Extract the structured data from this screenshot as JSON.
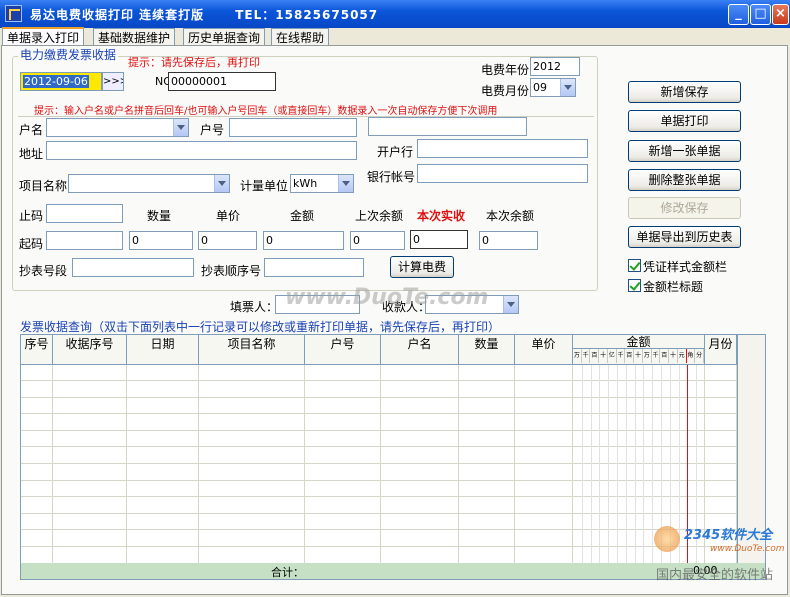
{
  "window": {
    "title": "易达电费收据打印 连续套打版      TEL：15825675057"
  },
  "tabs": [
    {
      "label": "单据录入打印",
      "active": true
    },
    {
      "label": "基础数据维护",
      "active": false
    },
    {
      "label": "历史单据查询",
      "active": false
    },
    {
      "label": "在线帮助",
      "active": false
    }
  ],
  "form": {
    "section_title": "电力缴费发票收据",
    "tip_top": "提示：请先保存后，再打印",
    "date_value": "2012-09-06",
    "date_button": ">>>",
    "no_label": "NO",
    "no_value": "00000001",
    "year_label": "电费年份",
    "year_value": "2012",
    "month_label": "电费月份",
    "month_value": "09",
    "tip_main": "提示：输入户名或户名拼音后回车/也可输入户号回车（或直接回车）数据录入一次自动保存方便下次调用",
    "huming_label": "户名",
    "huhao_label": "户号",
    "address_label": "地址",
    "bank_label": "开户行",
    "item_label": "项目名称",
    "unit_label": "计量单位",
    "unit_value": "kWh",
    "account_label": "银行帐号",
    "stop_label": "止码",
    "start_label": "起码",
    "qty_label": "数量",
    "price_label": "单价",
    "amount_label": "金额",
    "prev_balance_label": "上次余额",
    "actual_label": "本次实收",
    "curr_balance_label": "本次余额",
    "qty_value": "0",
    "price_value": "0",
    "amount_value": "0",
    "prev_balance_value": "0",
    "actual_value": "0",
    "curr_balance_value": "0",
    "meter_seg_label": "抄表号段",
    "meter_seq_label": "抄表顺序号",
    "calc_button": "计算电费",
    "filler_label": "填票人：",
    "receiver_label": "收款人："
  },
  "side_buttons": {
    "new_save": "新增保存",
    "print": "单据打印",
    "new_one": "新增一张单据",
    "delete_all": "删除整张单据",
    "modify_save": "修改保存",
    "export": "单据导出到历史表"
  },
  "checkboxes": {
    "voucher_style": "凭证样式金额栏",
    "amount_title": "金额栏标题"
  },
  "grid": {
    "title": "发票收据查询（双击下面列表中一行记录可以修改或重新打印单据，请先保存后，再打印）",
    "columns": [
      "序号",
      "收据序号",
      "日期",
      "项目名称",
      "户号",
      "户名",
      "数量",
      "单价",
      "金额",
      "月份"
    ],
    "amount_digits": [
      "万",
      "千",
      "百",
      "十",
      "亿",
      "千",
      "百",
      "十",
      "万",
      "千",
      "百",
      "十",
      "元",
      "角",
      "分"
    ],
    "total_label": "合计：",
    "total_value": "0.00"
  },
  "watermarks": {
    "center": "www.DuoTe.com",
    "corner_brand": "2345软件大全",
    "corner_url": "www.DuoTe.com",
    "corner_bottom": "国内最安全的软件站"
  },
  "colors": {
    "title_blue": "#0a56d8",
    "label_red": "#e01010",
    "label_blue": "#1a43b6",
    "highlight_yellow": "#ffe800"
  }
}
